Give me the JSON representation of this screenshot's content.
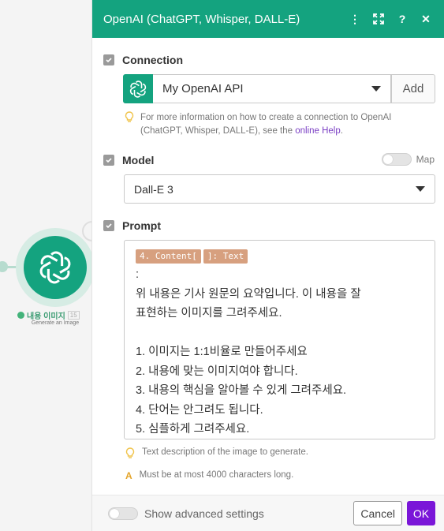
{
  "canvas": {
    "module_label": "내용 이미지",
    "module_number": "15",
    "module_sub": "Generate an Image"
  },
  "panel": {
    "title": "OpenAI (ChatGPT, Whisper, DALL-E)",
    "header_icons": [
      "kebab-icon",
      "expand-icon",
      "help-icon",
      "close-icon"
    ],
    "header_glyphs": {
      "kebab": "⋮",
      "expand": "⛶",
      "help": "?",
      "close": "✕"
    },
    "accent": "#14a37f"
  },
  "connection": {
    "heading": "Connection",
    "selected": "My OpenAI API",
    "add_label": "Add",
    "hint_prefix": "For more information on how to create a connection to OpenAI (ChatGPT, Whisper, DALL-E), see the ",
    "hint_link": "online Help",
    "hint_suffix": "."
  },
  "model": {
    "heading": "Model",
    "map_label": "Map",
    "selected": "Dall-E 3"
  },
  "prompt": {
    "heading": "Prompt",
    "pills": [
      "4. Content[",
      "]: Text"
    ],
    "lines": [
      ":",
      "위 내용은 기사 원문의 요약입니다. 이 내용을 잘",
      "표현하는 이미지를 그려주세요.",
      "",
      "1. 이미지는 1:1비율로 만들어주세요",
      "2. 내용에 맞는 이미지여야 합니다.",
      "3. 내용의 핵심을 알아볼 수 있게 그려주세요.",
      "4. 단어는 안그려도 됩니다.",
      "5. 심플하게 그려주세요."
    ],
    "hint": "Text description of the image to generate.",
    "warn_glyph": "A",
    "limit": "Must be at most 4000 characters long."
  },
  "footer": {
    "advanced_label": "Show advanced settings",
    "cancel_label": "Cancel",
    "ok_label": "OK",
    "ok_color": "#7a16d8"
  }
}
